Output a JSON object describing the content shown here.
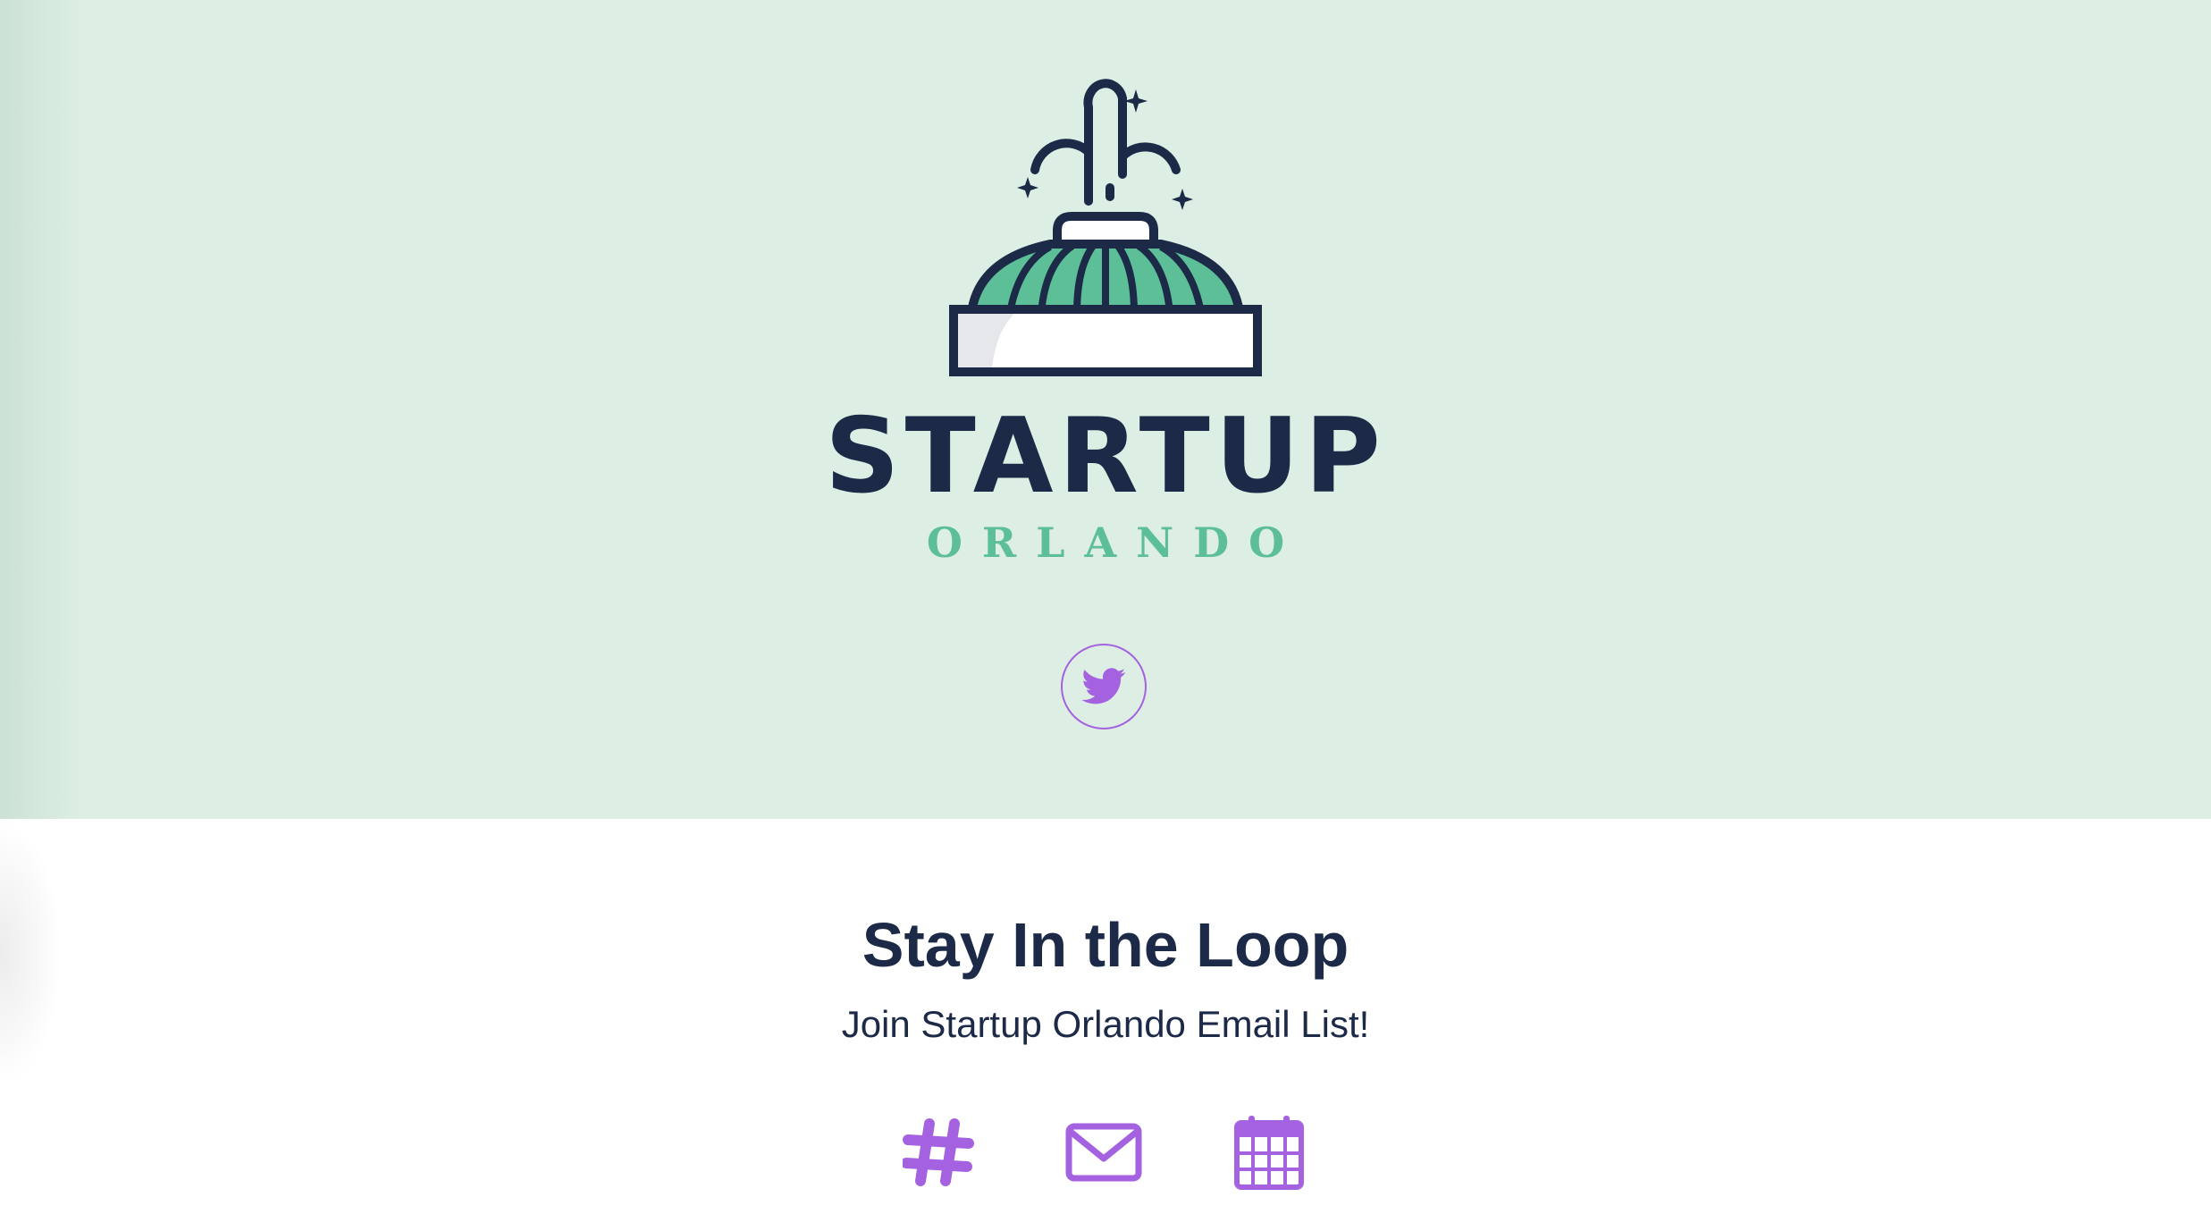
{
  "brand": {
    "title": "STARTUP",
    "subtitle": "ORLANDO"
  },
  "social": {
    "twitter_icon": "twitter-bird-icon"
  },
  "newsletter": {
    "title": "Stay In the Loop",
    "subtitle": "Join Startup Orlando Email List!"
  },
  "links": [
    {
      "icon": "slack-hash-icon"
    },
    {
      "icon": "envelope-icon"
    },
    {
      "icon": "calendar-icon"
    }
  ],
  "colors": {
    "hero_background": "#ddeee4",
    "navy": "#1c2947",
    "green": "#5cbf97",
    "purple": "#a462e0"
  }
}
